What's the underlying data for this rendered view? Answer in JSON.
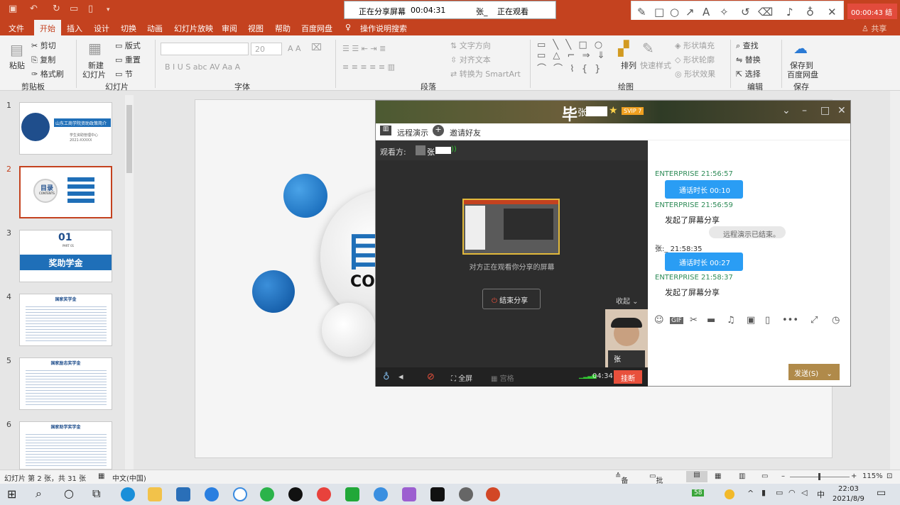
{
  "share_bar": {
    "status": "正在分享屏幕",
    "elapsed": "00:04:31",
    "viewer": "张_",
    "watching": "正在观看"
  },
  "toolbar_end": {
    "timer": "00:00:43",
    "end_label": "结束"
  },
  "menu": [
    "文件",
    "开始",
    "插入",
    "设计",
    "切换",
    "动画",
    "幻灯片放映",
    "审阅",
    "视图",
    "帮助",
    "百度网盘",
    "操作说明搜索"
  ],
  "share_label": "共享",
  "ribbon": {
    "clipboard": {
      "paste": "粘贴",
      "cut": "剪切",
      "copy": "复制",
      "format": "格式刷",
      "group": "剪贴板"
    },
    "slides": {
      "new": "新建",
      "new2": "幻灯片",
      "layout": "版式",
      "reset": "重置",
      "section": "节",
      "group": "幻灯片"
    },
    "font": {
      "size": "20",
      "group": "字体"
    },
    "paragraph": {
      "textdir": "文字方向",
      "align": "对齐文本",
      "smartart": "转换为 SmartArt",
      "group": "段落"
    },
    "drawing": {
      "arrange": "排列",
      "quickstyle": "快速样式",
      "fill": "形状填充",
      "outline": "形状轮廓",
      "effect": "形状效果",
      "group": "绘图"
    },
    "editing": {
      "find": "查找",
      "replace": "替换",
      "select": "选择",
      "group": "编辑"
    },
    "save": {
      "l1": "保存到",
      "l2": "百度网盘",
      "group": "保存"
    }
  },
  "thumbs": [
    {
      "num": "1",
      "title": "山东工商学院资助政策简介",
      "sub1": "学生资助管理中心",
      "sub2": "2021-XXXXX"
    },
    {
      "num": "2",
      "title": "目录",
      "sub": "CONTENTS"
    },
    {
      "num": "3",
      "title": "01",
      "sub": "PART 01",
      "banner": "奖助学金"
    },
    {
      "num": "4",
      "title": "国家奖学金"
    },
    {
      "num": "5",
      "title": "国家励志奖学金"
    },
    {
      "num": "6",
      "title": "国家助学奖学金"
    }
  ],
  "slide_main": {
    "big": "目",
    "sub": "CON"
  },
  "chat": {
    "title": "毕",
    "vip": "SVIP 7",
    "user": "张",
    "remote": "远程演示",
    "invite": "邀请好友",
    "viewers_label": "观看方:",
    "viewer_name": "张",
    "preview_text": "对方正在观看你分享的屏幕",
    "end_share": "结束分享",
    "collapse": "收起",
    "self_name": "张",
    "fullscreen": "全屏",
    "grid": "宫格",
    "duration": "04:34",
    "hangup": "挂断",
    "messages": [
      {
        "sender": "ENTERPRISE",
        "time": "21:56:57"
      },
      {
        "bubble": "通话时长 00:10"
      },
      {
        "sender": "ENTERPRISE",
        "time": "21:56:59"
      },
      {
        "text": "发起了屏幕分享"
      },
      {
        "sys": "远程演示已结束。"
      },
      {
        "sender": "张:_",
        "time": "21:58:35"
      },
      {
        "bubble": "通话时长 00:27"
      },
      {
        "sender": "ENTERPRISE",
        "time": "21:58:37"
      },
      {
        "text": "发起了屏幕分享"
      }
    ],
    "send": "发送(S)"
  },
  "status": {
    "slide_info": "幻灯片 第 2 张，共 31 张",
    "lang": "中文(中国)",
    "notes": "备注",
    "comments": "批注",
    "zoom": "115%"
  },
  "taskbar": {
    "battery": "58",
    "time": "22:03",
    "date": "2021/8/9",
    "ime": "中"
  }
}
